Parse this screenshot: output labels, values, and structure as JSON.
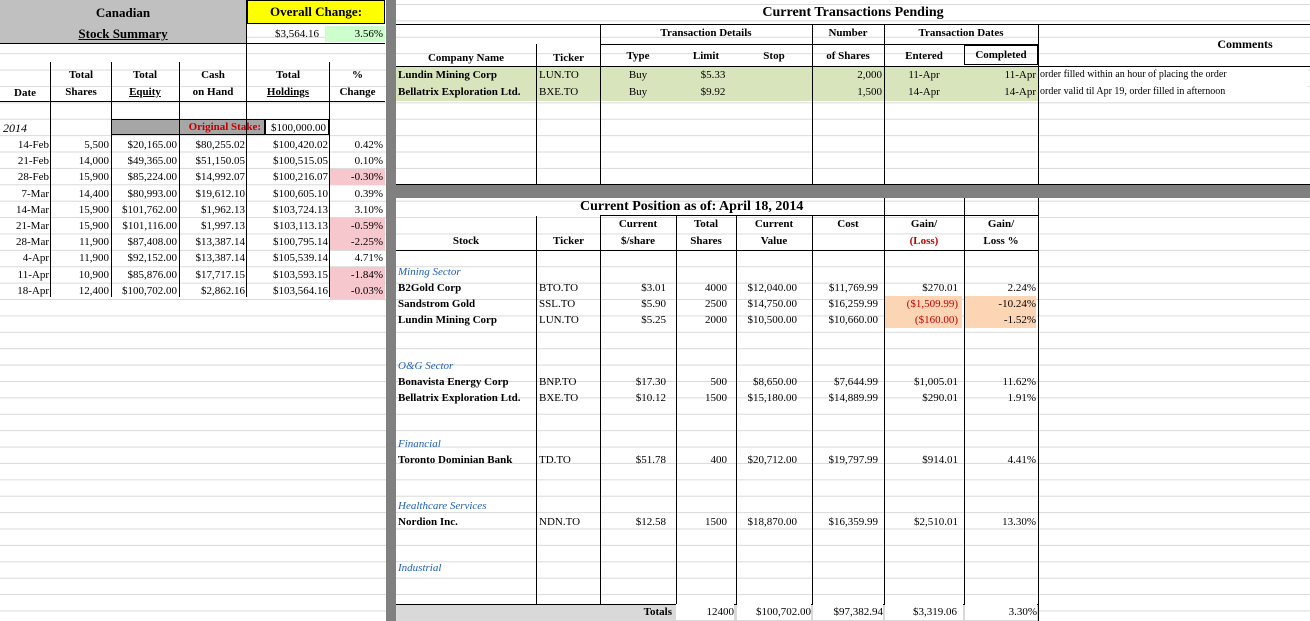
{
  "summary": {
    "title1": "Canadian",
    "title2": "Stock Summary",
    "overall_change_label": "Overall Change:",
    "overall_change_value": "$3,564.16",
    "overall_change_pct": "3.56%",
    "headers": {
      "date": "Date",
      "total_shares1": "Total",
      "total_shares2": "Shares",
      "total_equity1": "Total",
      "total_equity2": "Equity",
      "cash1": "Cash",
      "cash2": "on Hand",
      "holdings1": "Total",
      "holdings2": "Holdings",
      "pct1": "%",
      "pct2": "Change"
    },
    "year": "2014",
    "original_stake_label": "Original Stake:",
    "original_stake_value": "$100,000.00",
    "rows": [
      {
        "date": "14-Feb",
        "shares": "5,500",
        "equity": "$20,165.00",
        "cash": "$80,255.02",
        "holdings": "$100,420.02",
        "pct": "0.42%",
        "neg": false
      },
      {
        "date": "21-Feb",
        "shares": "14,000",
        "equity": "$49,365.00",
        "cash": "$51,150.05",
        "holdings": "$100,515.05",
        "pct": "0.10%",
        "neg": false
      },
      {
        "date": "28-Feb",
        "shares": "15,900",
        "equity": "$85,224.00",
        "cash": "$14,992.07",
        "holdings": "$100,216.07",
        "pct": "-0.30%",
        "neg": true
      },
      {
        "date": "7-Mar",
        "shares": "14,400",
        "equity": "$80,993.00",
        "cash": "$19,612.10",
        "holdings": "$100,605.10",
        "pct": "0.39%",
        "neg": false
      },
      {
        "date": "14-Mar",
        "shares": "15,900",
        "equity": "$101,762.00",
        "cash": "$1,962.13",
        "holdings": "$103,724.13",
        "pct": "3.10%",
        "neg": false
      },
      {
        "date": "21-Mar",
        "shares": "15,900",
        "equity": "$101,116.00",
        "cash": "$1,997.13",
        "holdings": "$103,113.13",
        "pct": "-0.59%",
        "neg": true
      },
      {
        "date": "28-Mar",
        "shares": "11,900",
        "equity": "$87,408.00",
        "cash": "$13,387.14",
        "holdings": "$100,795.14",
        "pct": "-2.25%",
        "neg": true
      },
      {
        "date": "4-Apr",
        "shares": "11,900",
        "equity": "$92,152.00",
        "cash": "$13,387.14",
        "holdings": "$105,539.14",
        "pct": "4.71%",
        "neg": false
      },
      {
        "date": "11-Apr",
        "shares": "10,900",
        "equity": "$85,876.00",
        "cash": "$17,717.15",
        "holdings": "$103,593.15",
        "pct": "-1.84%",
        "neg": true
      },
      {
        "date": "18-Apr",
        "shares": "12,400",
        "equity": "$100,702.00",
        "cash": "$2,862.16",
        "holdings": "$103,564.16",
        "pct": "-0.03%",
        "neg": true
      }
    ]
  },
  "pending": {
    "title": "Current Transactions Pending",
    "transaction_details": "Transaction Details",
    "number": "Number",
    "transaction_dates": "Transaction Dates",
    "comments": "Comments",
    "headers": {
      "company": "Company Name",
      "ticker": "Ticker",
      "type": "Type",
      "limit": "Limit",
      "stop": "Stop",
      "shares": "of Shares",
      "entered": "Entered",
      "completed": "Completed"
    },
    "rows": [
      {
        "company": "Lundin Mining Corp",
        "ticker": "LUN.TO",
        "type": "Buy",
        "limit": "$5.33",
        "stop": "",
        "shares": "2,000",
        "entered": "11-Apr",
        "completed": "11-Apr",
        "comment": "order filled within an hour of placing the order"
      },
      {
        "company": "Bellatrix Exploration Ltd.",
        "ticker": "BXE.TO",
        "type": "Buy",
        "limit": "$9.92",
        "stop": "",
        "shares": "1,500",
        "entered": "14-Apr",
        "completed": "14-Apr",
        "comment": "order valid til Apr 19, order filled in afternoon"
      }
    ]
  },
  "position": {
    "title": "Current Position as of:  April 18, 2014",
    "headers": {
      "stock": "Stock",
      "ticker": "Ticker",
      "cur1": "Current",
      "cur2": "$/share",
      "tot1": "Total",
      "tot2": "Shares",
      "val1": "Current",
      "val2": "Value",
      "cost": "Cost",
      "gain1": "Gain/",
      "gain2": "(Loss)",
      "gainpct1": "Gain/",
      "gainpct2": "Loss %"
    },
    "sectors": [
      {
        "name": "Mining Sector",
        "stocks": [
          {
            "name": "B2Gold Corp",
            "ticker": "BTO.TO",
            "price": "$3.01",
            "shares": "4000",
            "value": "$12,040.00",
            "cost": "$11,769.99",
            "gain": "$270.01",
            "pct": "2.24%",
            "loss": false
          },
          {
            "name": "Sandstrom Gold",
            "ticker": "SSL.TO",
            "price": "$5.90",
            "shares": "2500",
            "value": "$14,750.00",
            "cost": "$16,259.99",
            "gain": "($1,509.99)",
            "pct": "-10.24%",
            "loss": true
          },
          {
            "name": "Lundin Mining Corp",
            "ticker": "LUN.TO",
            "price": "$5.25",
            "shares": "2000",
            "value": "$10,500.00",
            "cost": "$10,660.00",
            "gain": "($160.00)",
            "pct": "-1.52%",
            "loss": true
          }
        ]
      },
      {
        "name": "O&G Sector",
        "stocks": [
          {
            "name": "Bonavista Energy Corp",
            "ticker": "BNP.TO",
            "price": "$17.30",
            "shares": "500",
            "value": "$8,650.00",
            "cost": "$7,644.99",
            "gain": "$1,005.01",
            "pct": "11.62%",
            "loss": false
          },
          {
            "name": "Bellatrix Exploration Ltd.",
            "ticker": "BXE.TO",
            "price": "$10.12",
            "shares": "1500",
            "value": "$15,180.00",
            "cost": "$14,889.99",
            "gain": "$290.01",
            "pct": "1.91%",
            "loss": false
          }
        ]
      },
      {
        "name": "Financial",
        "stocks": [
          {
            "name": "Toronto Dominian Bank",
            "ticker": "TD.TO",
            "price": "$51.78",
            "shares": "400",
            "value": "$20,712.00",
            "cost": "$19,797.99",
            "gain": "$914.01",
            "pct": "4.41%",
            "loss": false
          }
        ]
      },
      {
        "name": "Healthcare Services",
        "stocks": [
          {
            "name": "Nordion Inc.",
            "ticker": "NDN.TO",
            "price": "$12.58",
            "shares": "1500",
            "value": "$18,870.00",
            "cost": "$16,359.99",
            "gain": "$2,510.01",
            "pct": "13.30%",
            "loss": false
          }
        ]
      },
      {
        "name": "Industrial",
        "stocks": []
      }
    ],
    "totals": {
      "label": "Totals",
      "shares": "12400",
      "value": "$100,702.00",
      "cost": "$97,382.94",
      "gain": "$3,319.06",
      "pct": "3.30%"
    }
  },
  "colors": {
    "header_gray": "#c0c0c0",
    "yellow": "#ffff00",
    "green": "#ccffcc",
    "pending_green": "#d8e4bc",
    "orange": "#fcd5b4",
    "pink": "#f7c7ce",
    "sector_blue": "#1f5fb5",
    "loss_red": "#c00000"
  }
}
